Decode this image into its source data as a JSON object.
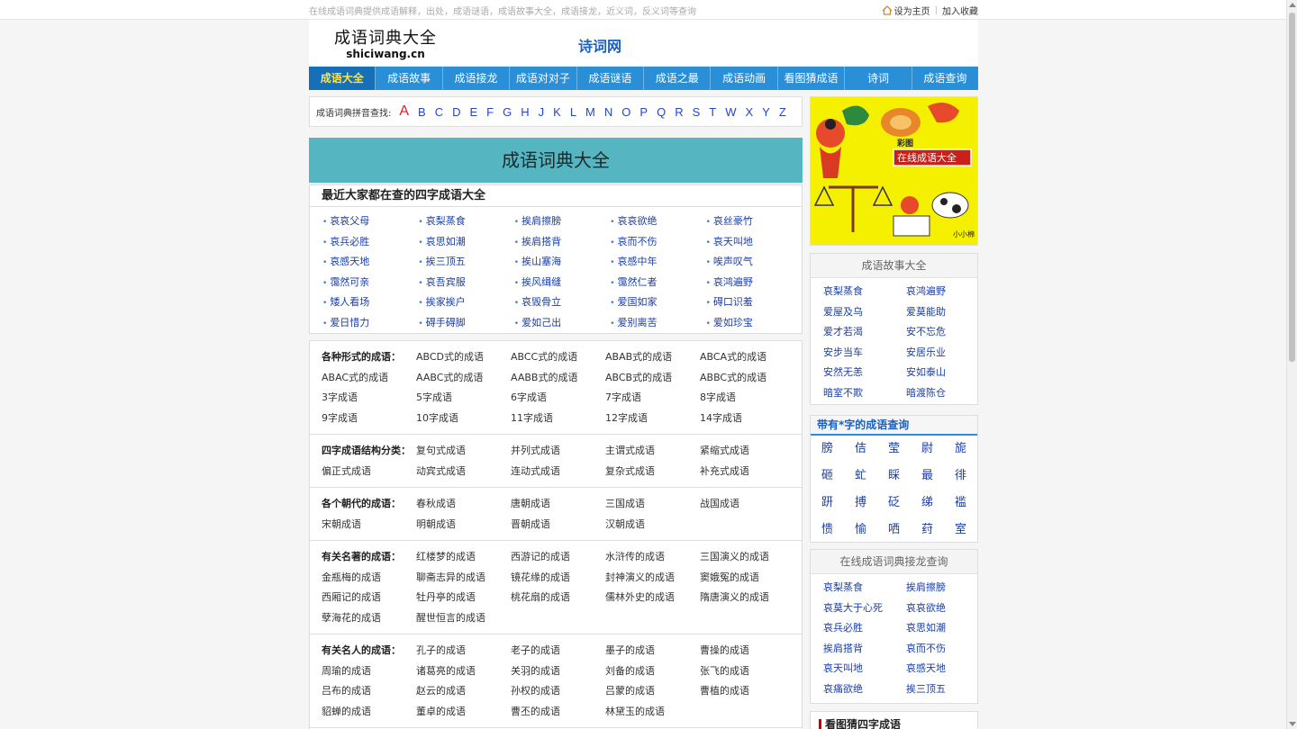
{
  "topbar": {
    "tagline": "在线成语词典提供成语解释，出处，成语谜语，成语故事大全，成语接龙，近义词，反义词等查询",
    "set_home": "设为主页",
    "bookmark": "加入收藏"
  },
  "header": {
    "logo_cn": "成语词典大全",
    "logo_en": "shiciwang.cn",
    "site_link": "诗词网"
  },
  "nav": [
    "成语大全",
    "成语故事",
    "成语接龙",
    "成语对对子",
    "成语谜语",
    "成语之最",
    "成语动画",
    "看图猜成语",
    "诗词",
    "成语查询"
  ],
  "alpha": {
    "label": "成语词典拼音查找:",
    "letters": [
      "A",
      "B",
      "C",
      "D",
      "E",
      "F",
      "G",
      "H",
      "J",
      "K",
      "L",
      "M",
      "N",
      "O",
      "P",
      "Q",
      "R",
      "S",
      "T",
      "W",
      "X",
      "Y",
      "Z"
    ]
  },
  "banner": {
    "title": "成语词典大全"
  },
  "recent": {
    "title": "最近大家都在查的四字成语大全",
    "items": [
      "哀哀父母",
      "哀梨蒸食",
      "挨肩擦膀",
      "哀哀欲绝",
      "哀丝豪竹",
      "哀兵必胜",
      "哀思如潮",
      "挨肩搭背",
      "哀而不伤",
      "哀天叫地",
      "哀感天地",
      "挨三顶五",
      "挨山塞海",
      "哀感中年",
      "唉声叹气",
      "霭然可亲",
      "哀吾宾服",
      "挨风缉缝",
      "霭然仁者",
      "哀鸿遍野",
      "矮人看场",
      "挨家挨户",
      "哀毁骨立",
      "爱国如家",
      "碍口识羞",
      "爱日惜力",
      "碍手碍脚",
      "爱如己出",
      "爱别离苦",
      "爱如珍宝"
    ]
  },
  "categories": [
    {
      "label": "各种形式的成语：",
      "rows": [
        [
          "ABCD式的成语",
          "ABCC式的成语",
          "ABAB式的成语",
          "ABCA式的成语"
        ],
        [
          "ABAC式的成语",
          "AABC式的成语",
          "AABB式的成语",
          "ABCB式的成语",
          "ABBC式的成语"
        ],
        [
          "3字成语",
          "5字成语",
          "6字成语",
          "7字成语",
          "8字成语"
        ],
        [
          "9字成语",
          "10字成语",
          "11字成语",
          "12字成语",
          "14字成语"
        ]
      ]
    },
    {
      "label": "四字成语结构分类：",
      "rows": [
        [
          "复句式成语",
          "并列式成语",
          "主谓式成语",
          "紧缩式成语"
        ],
        [
          "偏正式成语",
          "动宾式成语",
          "连动式成语",
          "复杂式成语",
          "补充式成语"
        ]
      ]
    },
    {
      "label": "各个朝代的成语：",
      "rows": [
        [
          "春秋成语",
          "唐朝成语",
          "三国成语",
          "战国成语"
        ],
        [
          "宋朝成语",
          "明朝成语",
          "晋朝成语",
          "汉朝成语"
        ]
      ]
    },
    {
      "label": "有关名著的成语：",
      "rows": [
        [
          "红楼梦的成语",
          "西游记的成语",
          "水浒传的成语",
          "三国演义的成语"
        ],
        [
          "金瓶梅的成语",
          "聊斋志异的成语",
          "镜花缘的成语",
          "封神演义的成语",
          "窦娥冤的成语"
        ],
        [
          "西厢记的成语",
          "牡丹亭的成语",
          "桃花扇的成语",
          "儒林外史的成语",
          "隋唐演义的成语"
        ],
        [
          "孽海花的成语",
          "醒世恒言的成语"
        ]
      ]
    },
    {
      "label": "有关名人的成语：",
      "rows": [
        [
          "孔子的成语",
          "老子的成语",
          "墨子的成语",
          "曹操的成语"
        ],
        [
          "周瑜的成语",
          "诸葛亮的成语",
          "关羽的成语",
          "刘备的成语",
          "张飞的成语"
        ],
        [
          "吕布的成语",
          "赵云的成语",
          "孙权的成语",
          "吕蒙的成语",
          "曹植的成语"
        ],
        [
          "貂蝉的成语",
          "董卓的成语",
          "曹丕的成语",
          "林黛玉的成语"
        ]
      ]
    }
  ],
  "side": {
    "ad_label_small": "彩图",
    "ad_label": "在线成语大全",
    "ad_sign": "小小棉",
    "stories_title": "成语故事大全",
    "stories": [
      "哀梨蒸食",
      "哀鸿遍野",
      "爱屋及乌",
      "爱莫能助",
      "爱才若渴",
      "安不忘危",
      "安步当车",
      "安居乐业",
      "安然无恙",
      "安如泰山",
      "暗室不欺",
      "暗渡陈仓"
    ],
    "chars_title": "带有*字的成语查询",
    "chars": [
      "膀",
      "佶",
      "莹",
      "尉",
      "旎",
      "砸",
      "虻",
      "睬",
      "最",
      "徘",
      "趼",
      "搏",
      "砭",
      "绨",
      "褴",
      "愦",
      "愉",
      "哂",
      "荮",
      "室"
    ],
    "jielong_title": "在线成语词典接龙查询",
    "jielong": [
      "哀梨蒸食",
      "挨肩擦膀",
      "哀莫大于心死",
      "哀哀欲绝",
      "哀兵必胜",
      "哀思如潮",
      "挨肩搭背",
      "哀而不伤",
      "哀天叫地",
      "哀感天地",
      "哀痛欲绝",
      "挨三顶五"
    ],
    "bottom_title": "看图猜四字成语"
  }
}
